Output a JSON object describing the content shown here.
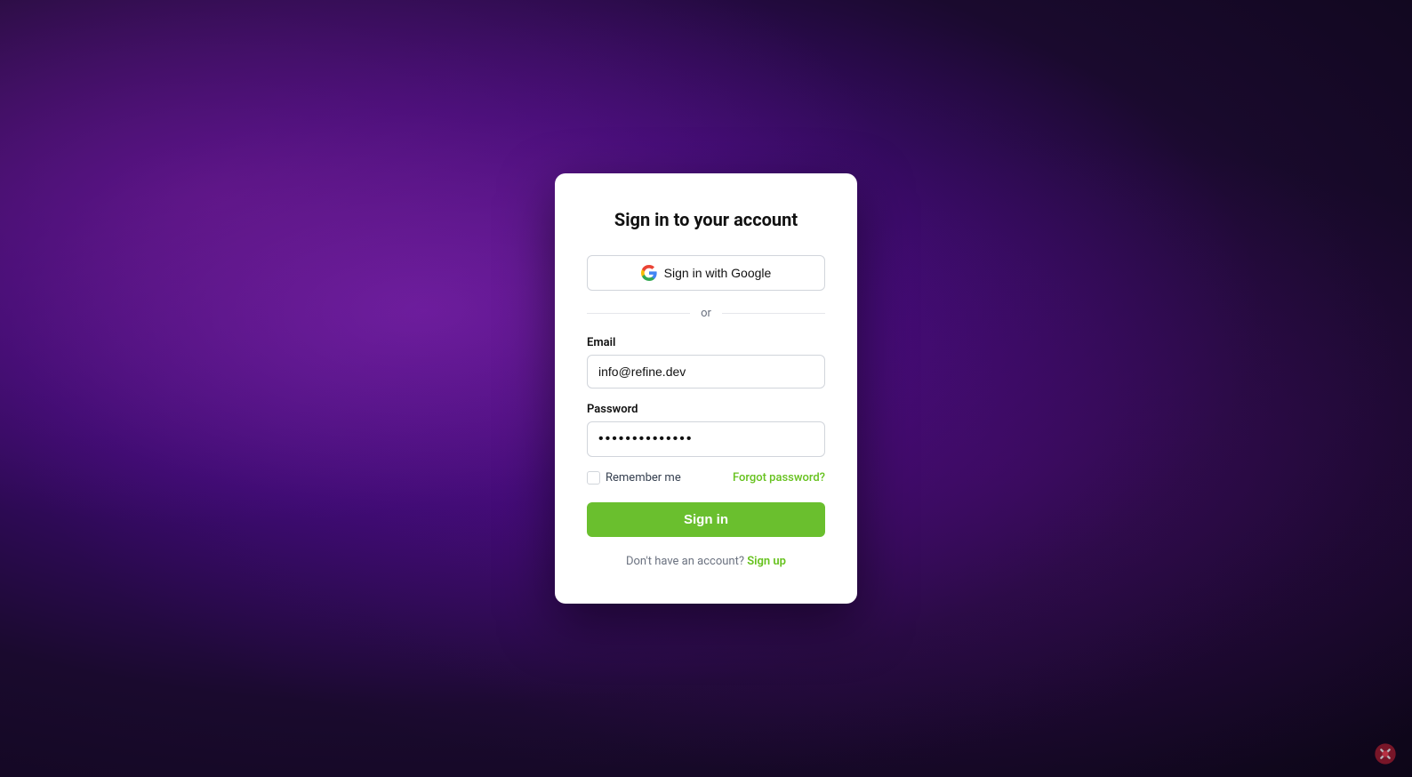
{
  "page": {
    "background": "dark purple gradient"
  },
  "card": {
    "title": "Sign in to your account",
    "google_button_label": "Sign in with Google",
    "divider_text": "or",
    "email_label": "Email",
    "email_value": "info@refine.dev",
    "email_placeholder": "info@refine.dev",
    "password_label": "Password",
    "password_value": "••••••••••••••",
    "remember_me_label": "Remember me",
    "forgot_password_label": "Forgot password?",
    "sign_in_button_label": "Sign in",
    "no_account_text": "Don't have an account?",
    "sign_up_label": "Sign up"
  }
}
